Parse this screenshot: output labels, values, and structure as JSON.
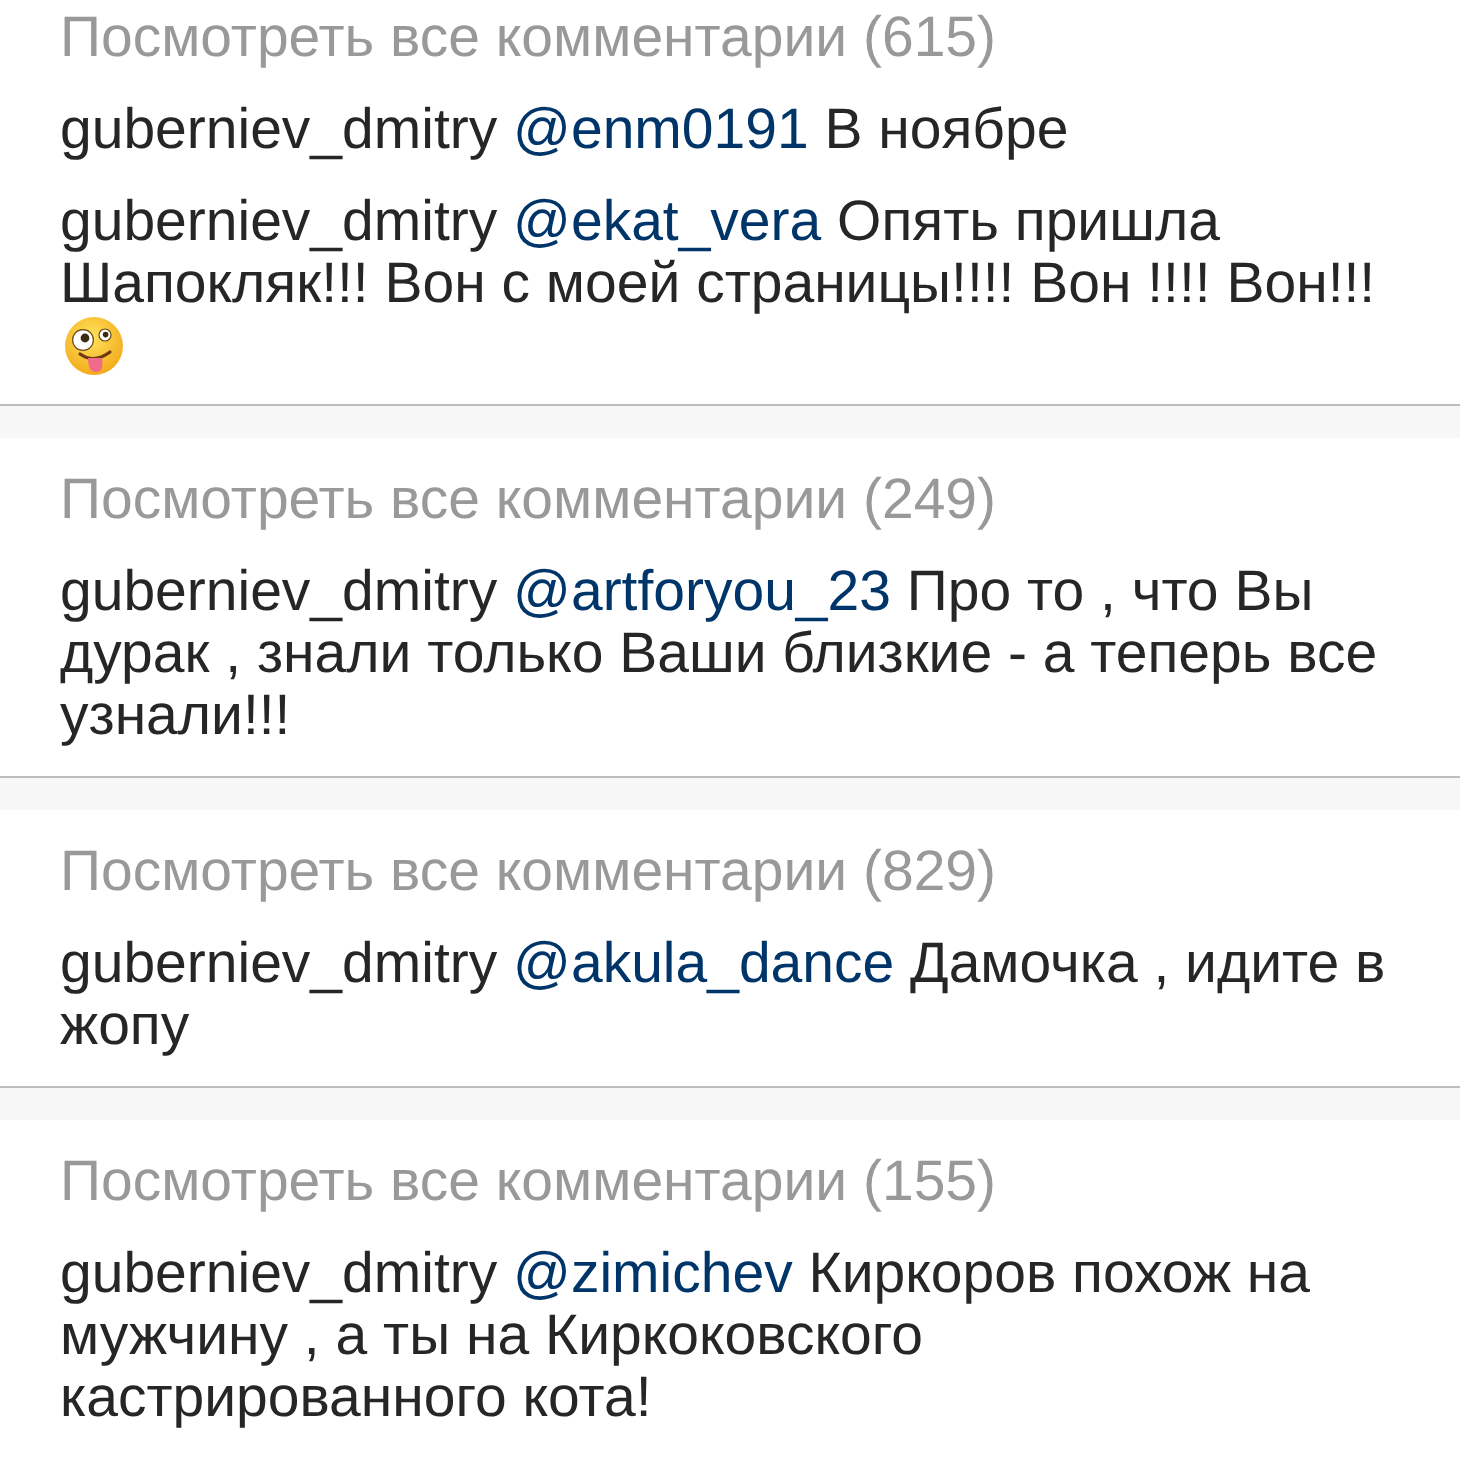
{
  "cards": [
    {
      "view_all": "Посмотреть все комментарии (615)",
      "comments": [
        {
          "user": "guberniev_dmitry",
          "mention": "@enm0191",
          "text": "В ноябре",
          "emoji": false
        },
        {
          "user": "guberniev_dmitry",
          "mention": "@ekat_vera",
          "text": "Опять пришла Шапокляк!!! Вон с моей страницы!!!! Вон !!!! Вон!!!",
          "emoji": true
        }
      ]
    },
    {
      "view_all": "Посмотреть все комментарии (249)",
      "comments": [
        {
          "user": "guberniev_dmitry",
          "mention": "@artforyou_23",
          "text": "Про то , что Вы дурак , знали только Ваши близкие - а теперь все узнали!!!",
          "emoji": false
        }
      ]
    },
    {
      "view_all": "Посмотреть все комментарии (829)",
      "comments": [
        {
          "user": "guberniev_dmitry",
          "mention": "@akula_dance",
          "text": "Дамочка , идите в жопу",
          "emoji": false
        }
      ]
    },
    {
      "view_all": "Посмотреть все комментарии (155)",
      "comments": [
        {
          "user": "guberniev_dmitry",
          "mention": "@zimichev",
          "text": "Киркоров похож на мужчину , а ты на Киркоковского кастрированного кота!",
          "emoji": false
        }
      ]
    }
  ]
}
